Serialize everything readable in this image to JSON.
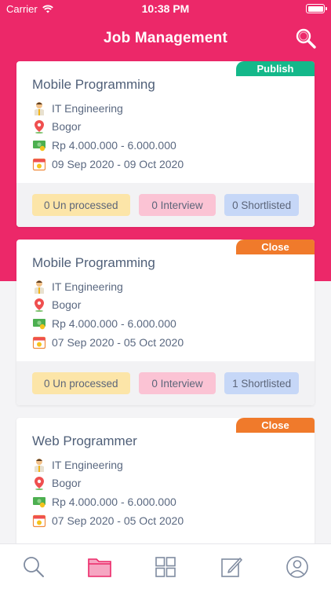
{
  "status_bar": {
    "carrier": "Carrier",
    "time": "10:38 PM"
  },
  "header": {
    "title": "Job Management"
  },
  "jobs": [
    {
      "title": "Mobile Programming",
      "status": "Publish",
      "status_color": "#14b88a",
      "department": "IT Engineering",
      "location": "Bogor",
      "salary": "Rp 4.000.000 - 6.000.000",
      "dates": "09 Sep 2020 - 09 Oct 2020",
      "unprocessed": "0 Un processed",
      "interview": "0 Interview",
      "shortlisted": "0 Shortlisted"
    },
    {
      "title": "Mobile Programming",
      "status": "Close",
      "status_color": "#f07a2b",
      "department": "IT Engineering",
      "location": "Bogor",
      "salary": "Rp 4.000.000 - 6.000.000",
      "dates": "07 Sep 2020 - 05 Oct 2020",
      "unprocessed": "0 Un processed",
      "interview": "0 Interview",
      "shortlisted": "1 Shortlisted"
    },
    {
      "title": "Web Programmer",
      "status": "Close",
      "status_color": "#f07a2b",
      "department": "IT Engineering",
      "location": "Bogor",
      "salary": "Rp 4.000.000 - 6.000.000",
      "dates": "07 Sep 2020 - 05 Oct 2020"
    }
  ],
  "tabbar": {
    "items": [
      "search-icon",
      "folder-icon",
      "grid-icon",
      "edit-icon",
      "profile-icon"
    ],
    "active": "folder-icon",
    "active_color": "#ec2869"
  },
  "colors": {
    "brand": "#ec2869"
  }
}
